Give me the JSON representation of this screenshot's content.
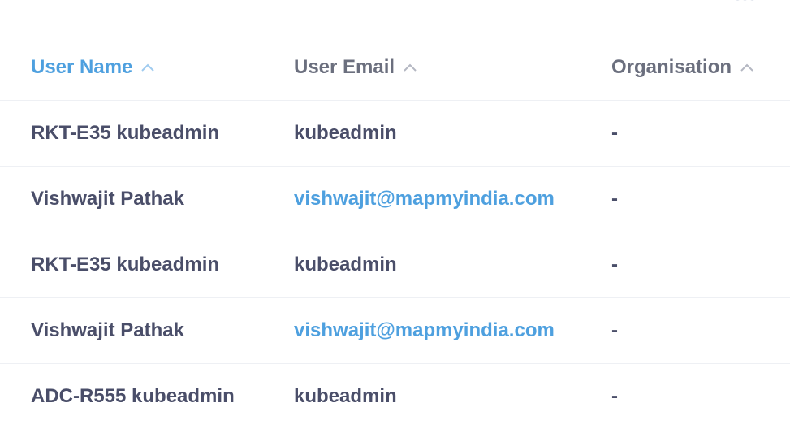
{
  "table": {
    "headers": [
      {
        "label": "User Name",
        "active": true
      },
      {
        "label": "User Email",
        "active": false
      },
      {
        "label": "Organisation",
        "active": false
      }
    ],
    "rows": [
      {
        "name": "RKT-E35 kubeadmin",
        "email": "kubeadmin",
        "email_is_link": false,
        "organisation": "-"
      },
      {
        "name": "Vishwajit Pathak",
        "email": "vishwajit@mapmyindia.com",
        "email_is_link": true,
        "organisation": "-"
      },
      {
        "name": "RKT-E35 kubeadmin",
        "email": "kubeadmin",
        "email_is_link": false,
        "organisation": "-"
      },
      {
        "name": "Vishwajit Pathak",
        "email": "vishwajit@mapmyindia.com",
        "email_is_link": true,
        "organisation": "-"
      },
      {
        "name": "ADC-R555 kubeadmin",
        "email": "kubeadmin",
        "email_is_link": false,
        "organisation": "-"
      }
    ]
  },
  "icons": {
    "sort": "chevron-up-icon",
    "more": "more-options-icon"
  },
  "colors": {
    "accent": "#4ea0df",
    "text": "#4a4e69",
    "header_text": "#6b6f7e",
    "divider": "#eef0f4"
  }
}
